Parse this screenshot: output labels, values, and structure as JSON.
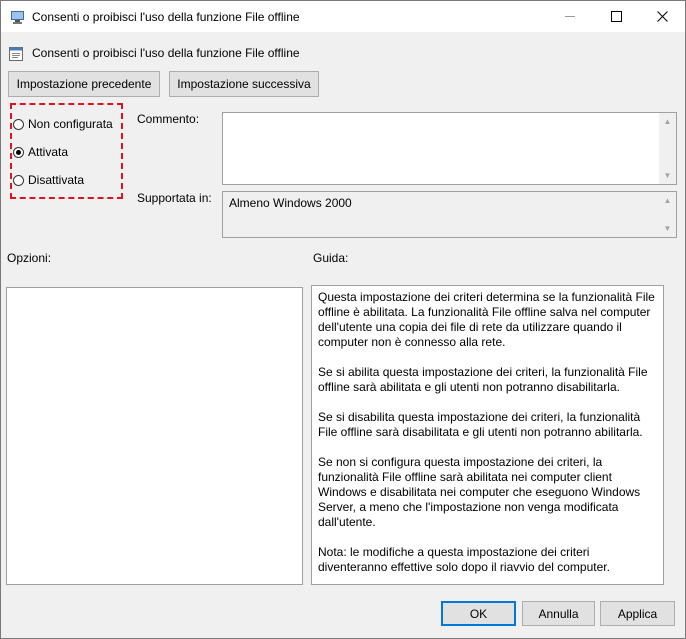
{
  "window": {
    "title": "Consenti o proibisci l'uso della funzione File offline"
  },
  "header": {
    "title": "Consenti o proibisci l'uso della funzione File offline"
  },
  "nav": {
    "previous_label": "Impostazione precedente",
    "next_label": "Impostazione successiva"
  },
  "state": {
    "options": [
      {
        "label": "Non configurata",
        "selected": false
      },
      {
        "label": "Attivata",
        "selected": true
      },
      {
        "label": "Disattivata",
        "selected": false
      }
    ]
  },
  "comment": {
    "label": "Commento:",
    "value": ""
  },
  "supported": {
    "label": "Supportata in:",
    "value": "Almeno Windows 2000"
  },
  "options_panel": {
    "label": "Opzioni:"
  },
  "help_panel": {
    "label": "Guida:",
    "paragraphs": [
      "Questa impostazione dei criteri determina se la funzionalità File offline è abilitata. La funzionalità File offline salva nel computer dell'utente una copia dei file di rete da utilizzare quando il computer non è connesso alla rete.",
      "Se si abilita questa impostazione dei criteri, la funzionalità File offline sarà abilitata e gli utenti non potranno disabilitarla.",
      "Se si disabilita questa impostazione dei criteri, la funzionalità File offline sarà disabilitata e gli utenti non potranno abilitarla.",
      "Se non si configura questa impostazione dei criteri, la funzionalità File offline sarà abilitata nei computer client Windows e disabilitata nei computer che eseguono Windows Server, a meno che l'impostazione non venga modificata dall'utente.",
      "Nota: le modifiche a questa impostazione dei criteri diventeranno effettive solo dopo il riavvio del computer."
    ]
  },
  "footer": {
    "ok_label": "OK",
    "cancel_label": "Annulla",
    "apply_label": "Applica"
  },
  "colors": {
    "highlight_border": "#e0141e",
    "default_button_border": "#0078d7"
  }
}
